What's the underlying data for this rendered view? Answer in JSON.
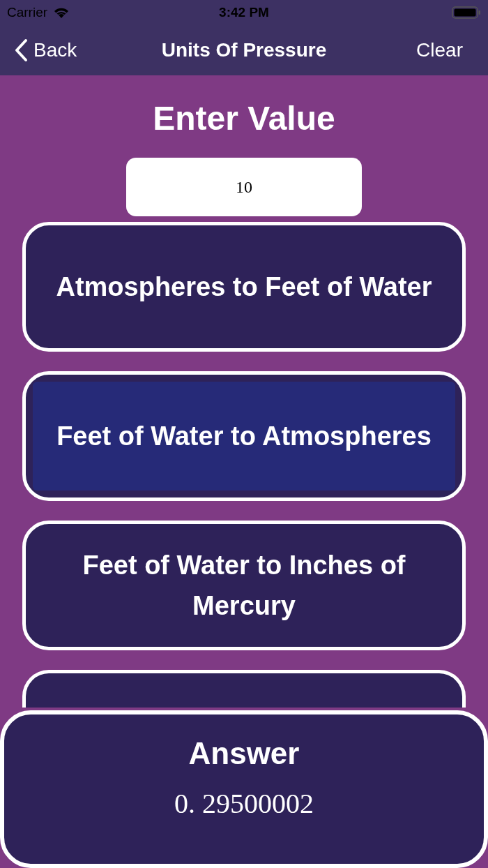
{
  "status_bar": {
    "carrier": "Carrier",
    "time": "3:42 PM"
  },
  "nav": {
    "back": "Back",
    "title": "Units Of Pressure",
    "action": "Clear"
  },
  "heading": "Enter Value",
  "input": {
    "value": "10"
  },
  "conversions": [
    {
      "label": "Atmospheres to Feet of Water",
      "selected": false
    },
    {
      "label": "Feet of Water to Atmospheres",
      "selected": true
    },
    {
      "label": "Feet of Water to Inches of Mercury",
      "selected": false
    },
    {
      "selected": false
    }
  ],
  "answer": {
    "title": "Answer",
    "value": "0. 29500002"
  }
}
